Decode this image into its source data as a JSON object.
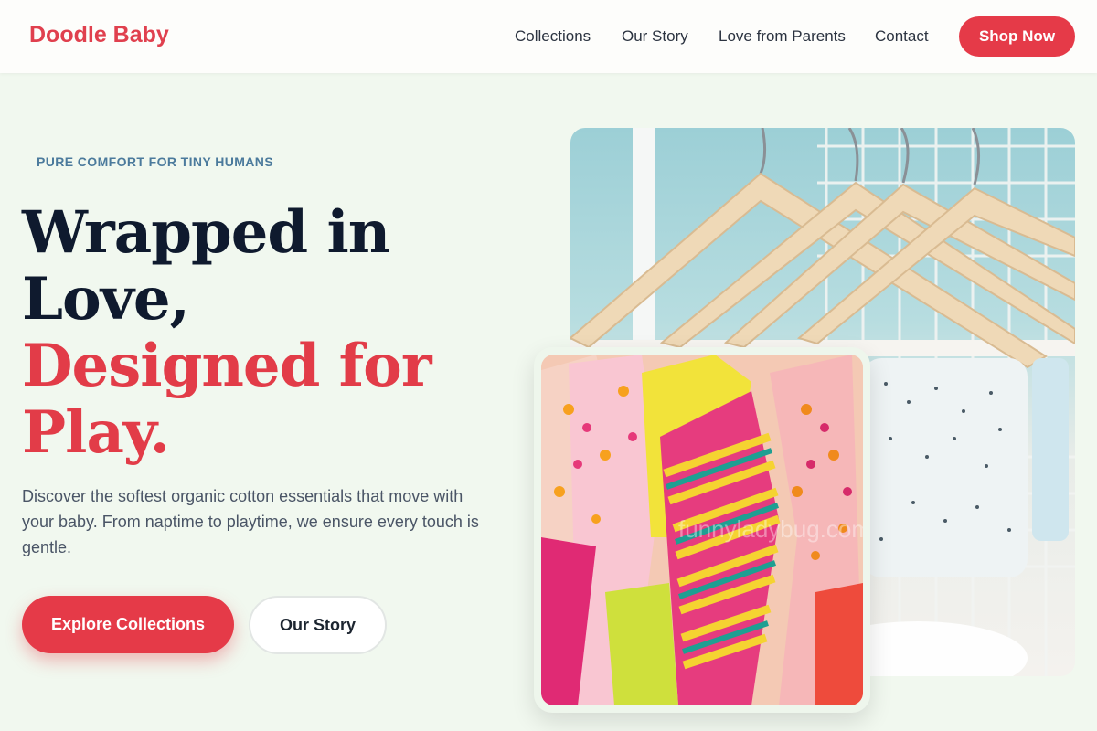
{
  "brand": {
    "name": "Doodle Baby"
  },
  "nav": {
    "links": [
      "Collections",
      "Our Story",
      "Love from Parents",
      "Contact"
    ],
    "cta": "Shop Now"
  },
  "hero": {
    "eyebrow": "PURE COMFORT FOR TINY HUMANS",
    "headline_dark_1": "Wrapped in",
    "headline_dark_2": "Love,",
    "headline_red_1": "Designed for",
    "headline_red_2": "Play.",
    "description": "Discover the softest organic cotton essentials that move with your baby. From naptime to playtime, we ensure every touch is gentle.",
    "primary_cta": "Explore Collections",
    "secondary_cta": "Our Story"
  },
  "images": {
    "back_photo": "wooden-hangers-white-rack-photo",
    "front_photo": "colorful-baby-clothes-rack-photo",
    "watermark": "funnyladybug.com"
  },
  "colors": {
    "accent": "#e53a48",
    "headline_dark": "#0f1a2e",
    "eyebrow": "#4b7a9c",
    "background": "#f1f8ef"
  }
}
